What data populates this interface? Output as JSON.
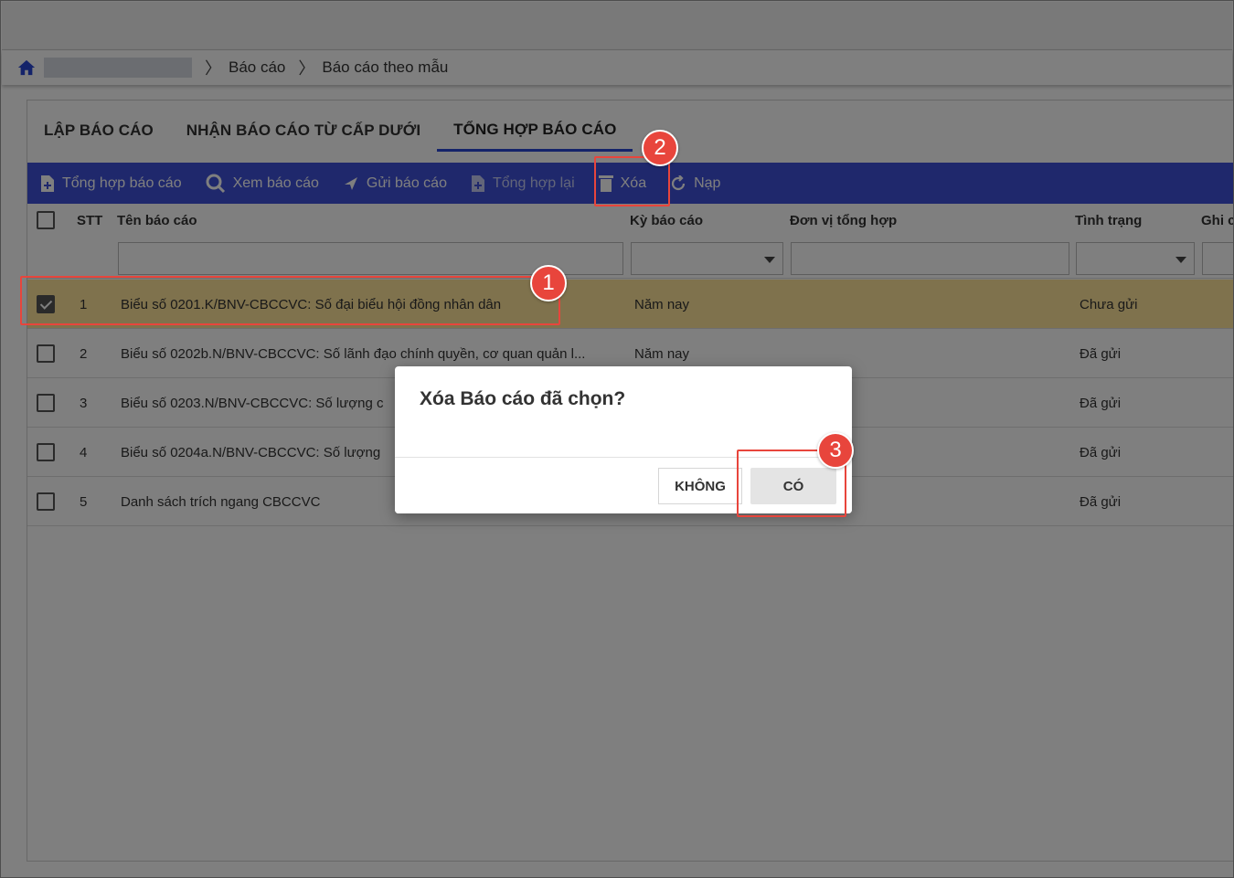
{
  "breadcrumb": {
    "items": [
      "Báo cáo",
      "Báo cáo theo mẫu"
    ]
  },
  "tabs": [
    {
      "label": "LẬP BÁO CÁO"
    },
    {
      "label": "NHẬN BÁO CÁO TỪ CẤP DƯỚI"
    },
    {
      "label": "TỔNG HỢP BÁO CÁO",
      "active": true
    }
  ],
  "toolbar": {
    "aggregate": "Tổng hợp báo cáo",
    "view": "Xem báo cáo",
    "send": "Gửi báo cáo",
    "reaggregate": "Tổng hợp lại",
    "delete": "Xóa",
    "reload": "Nạp"
  },
  "grid": {
    "headers": {
      "stt": "STT",
      "name": "Tên báo cáo",
      "period": "Kỳ báo cáo",
      "unit": "Đơn vị tổng hợp",
      "status": "Tình trạng",
      "note": "Ghi c"
    },
    "rows": [
      {
        "stt": "1",
        "name": "Biểu số 0201.K/BNV-CBCCVC: Số đại biểu hội đồng nhân dân",
        "period": "Năm nay",
        "status": "Chưa gửi",
        "checked": true
      },
      {
        "stt": "2",
        "name": "Biểu số 0202b.N/BNV-CBCCVC: Số lãnh đạo chính quyền, cơ quan quản l...",
        "period": "Năm nay",
        "status": "Đã gửi",
        "checked": false
      },
      {
        "stt": "3",
        "name": "Biểu số 0203.N/BNV-CBCCVC: Số lượng c",
        "period": "",
        "status": "Đã gửi",
        "checked": false
      },
      {
        "stt": "4",
        "name": "Biểu số 0204a.N/BNV-CBCCVC: Số lượng",
        "period": "",
        "status": "Đã gửi",
        "checked": false
      },
      {
        "stt": "5",
        "name": "Danh sách trích ngang CBCCVC",
        "period": "",
        "status": "Đã gửi",
        "checked": false
      }
    ]
  },
  "dialog": {
    "title": "Xóa Báo cáo đã chọn?",
    "no_label": "KHÔNG",
    "yes_label": "CÓ"
  },
  "markers": [
    "1",
    "2",
    "3"
  ],
  "colors": {
    "toolbar": "#3f51d8",
    "selected_row": "#ffe49a",
    "highlight": "#e8453c",
    "tab_underline": "#2946d4"
  }
}
